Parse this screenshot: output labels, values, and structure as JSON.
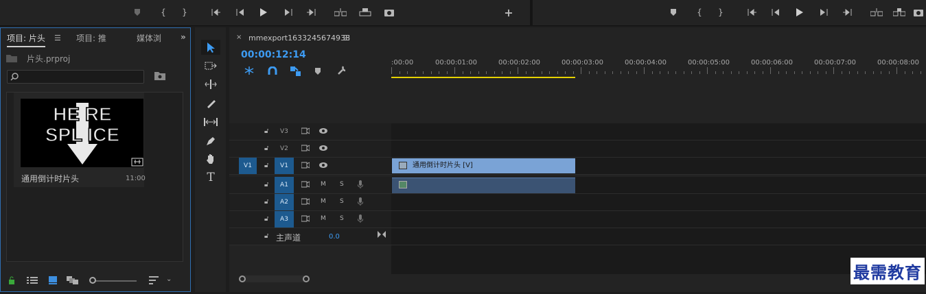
{
  "project_panel": {
    "tabs": [
      "项目: 片头",
      "项目: 推",
      "媒体浏"
    ],
    "project_file": "片头.prproj",
    "search_placeholder": "",
    "item": {
      "name": "通用倒计时片头",
      "duration": "11:00",
      "thumb_text_top": "HE RE",
      "thumb_text_bottom": "SPL ICE"
    }
  },
  "timeline": {
    "sequence_name": "mmexport1633245674938",
    "timecode": "00:00:12:14",
    "ruler_labels": [
      ":00:00",
      "00:00:01:00",
      "00:00:02:00",
      "00:00:03:00",
      "00:00:04:00",
      "00:00:05:00",
      "00:00:06:00",
      "00:00:07:00",
      "00:00:08:00"
    ],
    "video_tracks": [
      {
        "target": "",
        "name": "V3"
      },
      {
        "target": "",
        "name": "V2"
      },
      {
        "target": "V1",
        "name": "V1"
      }
    ],
    "audio_tracks": [
      {
        "name": "A1",
        "m": "M",
        "s": "S"
      },
      {
        "name": "A2",
        "m": "M",
        "s": "S"
      },
      {
        "name": "A3",
        "m": "M",
        "s": "S"
      }
    ],
    "master": {
      "label": "主声道",
      "value": "0.0"
    },
    "video_clip": "通用倒计时片头 [V]"
  },
  "watermark": "最需教育",
  "colors": {
    "accent": "#3d9bf2",
    "work_area": "#e6d300",
    "video_clip": "#7aa3d6",
    "audio_clip": "#3b5373"
  }
}
